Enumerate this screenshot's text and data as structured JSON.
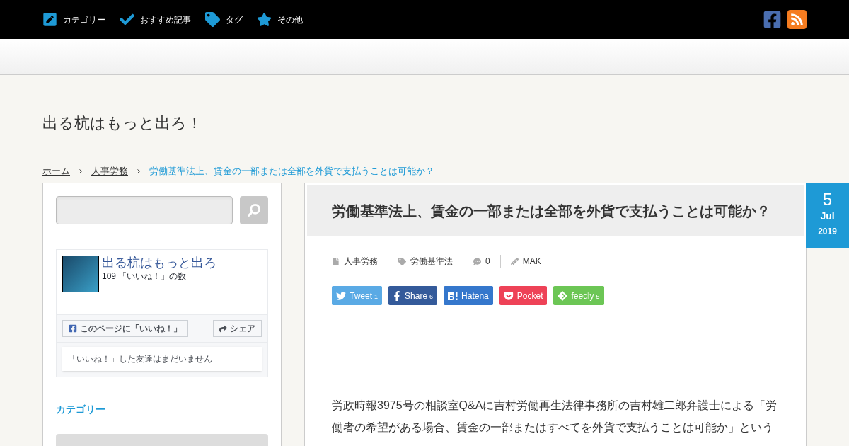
{
  "top_nav": [
    {
      "label": "カテゴリー",
      "kind": "edit"
    },
    {
      "label": "おすすめ記事",
      "kind": "check"
    },
    {
      "label": "タグ",
      "kind": "tag"
    },
    {
      "label": "その他",
      "kind": "star"
    }
  ],
  "site_title": "出る杭はもっと出ろ！",
  "breadcrumb": [
    {
      "label": "ホーム",
      "current": false
    },
    {
      "label": "人事労務",
      "current": false
    },
    {
      "label": "労働基準法上、賃金の一部または全部を外貨で支払うことは可能か？",
      "current": true
    }
  ],
  "sidebar": {
    "facebook_box": {
      "page_name": "出る杭はもっと出ろ",
      "likes": "109 「いいね！」の数",
      "like_button": "このページに「いいね！」",
      "share_button": "シェア",
      "friends_note": "「いいね！」した友達はまだいません"
    },
    "section_heading": "カテゴリー"
  },
  "article": {
    "title": "労働基準法上、賃金の一部または全部を外貨で支払うことは可能か？",
    "date": {
      "day": "5",
      "month": "Jul",
      "year": "2019"
    },
    "meta": [
      {
        "kind": "category",
        "label": "人事労務"
      },
      {
        "kind": "tag",
        "label": "労働基準法"
      },
      {
        "kind": "comments",
        "label": "0"
      },
      {
        "kind": "author",
        "label": "MAK"
      }
    ],
    "share_buttons": [
      {
        "kind": "twitter",
        "label": "Tweet",
        "count": "1",
        "color": "#5aaae5"
      },
      {
        "kind": "facebook",
        "label": "Share",
        "count": "6",
        "color": "#345a9a"
      },
      {
        "kind": "hatena",
        "label": "Hatena",
        "color": "#3577cc"
      },
      {
        "kind": "pocket",
        "label": "Pocket",
        "color": "#ee4257"
      },
      {
        "kind": "feedly",
        "label": "feedly",
        "count": "5",
        "color": "#6cc655"
      }
    ],
    "body": "労政時報3975号の相談室Q&Aに吉村労働再生法律事務所の吉村雄二郎弁護士による「労働者の希望がある場合、賃金の一部またはすべてを外貨で支払うことは可能か」という"
  }
}
